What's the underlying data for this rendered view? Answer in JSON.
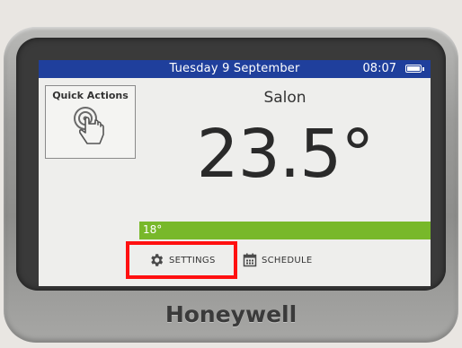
{
  "status_bar": {
    "date": "Tuesday  9 September",
    "time": "08:07",
    "battery_icon": "battery-icon"
  },
  "quick_actions": {
    "label": "Quick Actions",
    "icon": "tap-hand-icon"
  },
  "zone": {
    "name": "Salon",
    "temperature": "23.5°",
    "setpoint": "18°"
  },
  "nav": {
    "settings_label": "SETTINGS",
    "settings_icon": "gear-icon",
    "schedule_label": "SCHEDULE",
    "schedule_icon": "calendar-icon"
  },
  "device": {
    "brand": "Honeywell"
  },
  "colors": {
    "status_bar": "#1f3f9c",
    "setpoint_bar": "#78b82a",
    "highlight": "#ff1010"
  }
}
